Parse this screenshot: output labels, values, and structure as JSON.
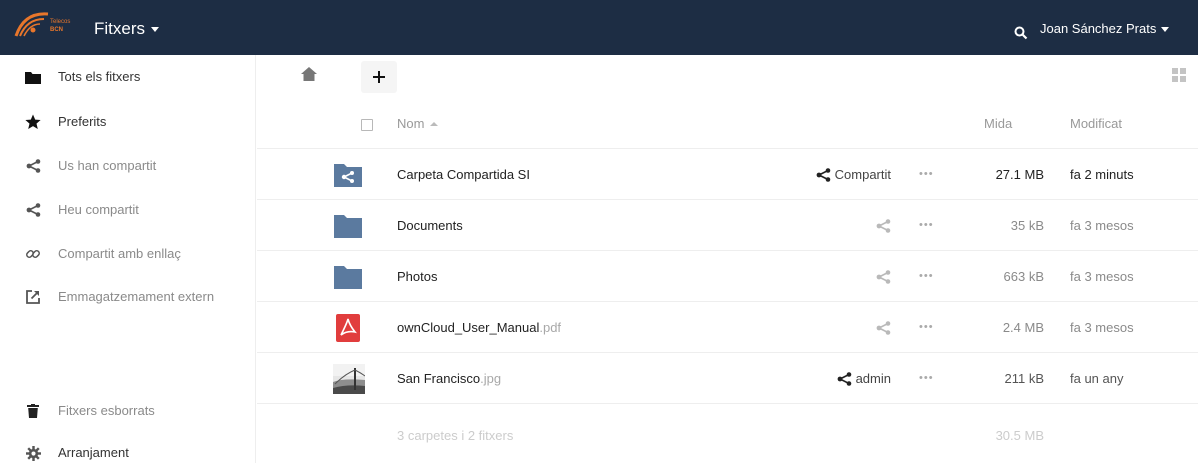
{
  "header": {
    "logo_text_top": "Telecos",
    "logo_text_bottom": "BCN",
    "app_title": "Fitxers",
    "user_name": "Joan Sánchez Prats"
  },
  "sidebar": {
    "items": [
      {
        "label": "Tots els fitxers",
        "icon": "folder-icon"
      },
      {
        "label": "Preferits",
        "icon": "star-icon"
      },
      {
        "label": "Us han compartit",
        "icon": "share-icon"
      },
      {
        "label": "Heu compartit",
        "icon": "share-icon"
      },
      {
        "label": "Compartit amb enllaç",
        "icon": "link-icon"
      },
      {
        "label": "Emmagatzemament extern",
        "icon": "external-icon"
      }
    ],
    "bottom_items": [
      {
        "label": "Fitxers esborrats",
        "icon": "trash-icon"
      },
      {
        "label": "Arranjament",
        "icon": "gear-icon"
      }
    ]
  },
  "table": {
    "headers": {
      "name": "Nom",
      "size": "Mida",
      "modified": "Modificat"
    },
    "rows": [
      {
        "name": "Carpeta Compartida SI",
        "ext": "",
        "type": "shared-folder",
        "share_label": "Compartit",
        "size": "27.1 MB",
        "modified": "fa 2 minuts"
      },
      {
        "name": "Documents",
        "ext": "",
        "type": "folder",
        "share_label": "",
        "size": "35 kB",
        "modified": "fa 3 mesos"
      },
      {
        "name": "Photos",
        "ext": "",
        "type": "folder",
        "share_label": "",
        "size": "663 kB",
        "modified": "fa 3 mesos"
      },
      {
        "name": "ownCloud_User_Manual",
        "ext": ".pdf",
        "type": "pdf",
        "share_label": "",
        "size": "2.4 MB",
        "modified": "fa 3 mesos"
      },
      {
        "name": "San Francisco",
        "ext": ".jpg",
        "type": "image",
        "share_label": "admin",
        "size": "211 kB",
        "modified": "fa un any"
      }
    ],
    "more_label": "•••",
    "summary": {
      "label": "3 carpetes i 2 fitxers",
      "size": "30.5 MB"
    }
  },
  "colors": {
    "header_bg": "#1d2d44",
    "folder": "#5b7a9f",
    "pdf": "#e13d3d",
    "logo_orange": "#e8762b"
  }
}
